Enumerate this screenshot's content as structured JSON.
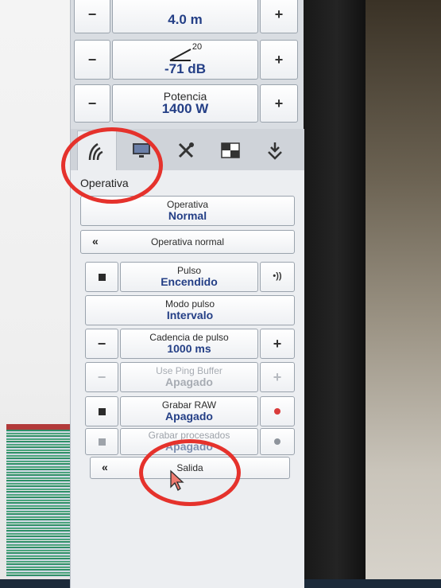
{
  "top_controls": {
    "depth": {
      "value": "4.0 m",
      "minus": "−",
      "plus": "+"
    },
    "gain": {
      "super": "20",
      "value": "-71 dB",
      "minus": "−",
      "plus": "+"
    },
    "power": {
      "label": "Potencia",
      "value": "1400 W",
      "minus": "−",
      "plus": "+"
    }
  },
  "tabs": [
    {
      "icon": "sonar-icon"
    },
    {
      "icon": "monitor-icon"
    },
    {
      "icon": "tools-icon"
    },
    {
      "icon": "layout-icon"
    },
    {
      "icon": "download-icon"
    }
  ],
  "section_title": "Operativa",
  "operativa": {
    "label": "Operativa",
    "value": "Normal"
  },
  "operativa_normal": {
    "label": "Operativa normal",
    "arrow": "«"
  },
  "pulso": {
    "label": "Pulso",
    "value": "Encendido",
    "right_icon": "•))"
  },
  "modo_pulso": {
    "label": "Modo pulso",
    "value": "Intervalo"
  },
  "cadencia": {
    "label": "Cadencia de pulso",
    "value": "1000 ms",
    "minus": "−",
    "plus": "+"
  },
  "ping_buffer": {
    "label": "Use Ping Buffer",
    "value": "Apagado",
    "minus": "−",
    "plus": "+"
  },
  "grabar_raw": {
    "label": "Grabar RAW",
    "value": "Apagado"
  },
  "grabar_procesados": {
    "label": "Grabar procesados",
    "value": "Apagado"
  },
  "salida": {
    "label": "Salida",
    "arrow": "«"
  },
  "colors": {
    "accent_blue": "#243f86",
    "annotation_red": "#e5322c",
    "record_red": "#d93b3b"
  }
}
